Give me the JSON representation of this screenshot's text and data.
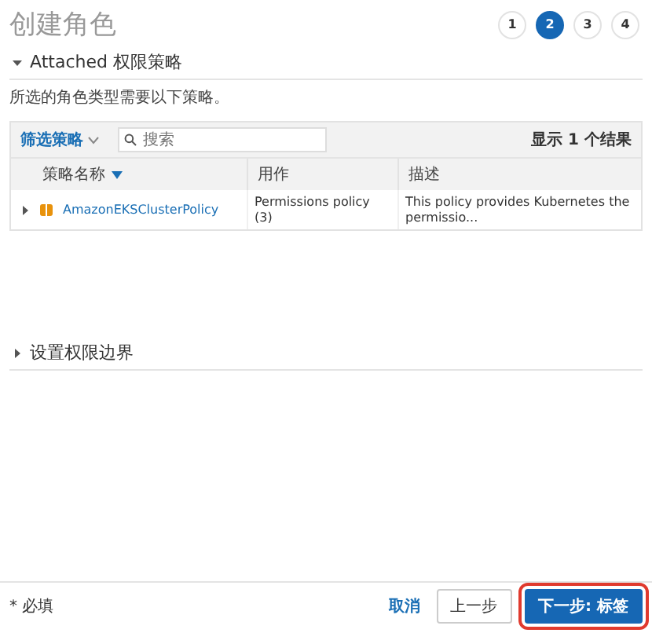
{
  "page_title": "创建角色",
  "steps": [
    {
      "label": "1",
      "selected": false
    },
    {
      "label": "2",
      "selected": true
    },
    {
      "label": "3",
      "selected": false
    },
    {
      "label": "4",
      "selected": false
    }
  ],
  "attached_section": {
    "title": "Attached 权限策略",
    "expanded": true,
    "description": "所选的角色类型需要以下策略。"
  },
  "toolbar": {
    "filter": "筛选策略",
    "search_placeholder": "搜索",
    "result_count": "显示 1 个结果"
  },
  "table": {
    "columns": [
      {
        "label": "策略名称",
        "sorted": true
      },
      {
        "label": "用作",
        "sorted": false
      },
      {
        "label": "描述",
        "sorted": false
      }
    ],
    "rows": [
      {
        "expanded": false,
        "name": "AmazonEKSClusterPolicy",
        "used_as": "Permissions policy (3)",
        "description": "This policy provides Kubernetes the permissio..."
      }
    ]
  },
  "boundary_section": {
    "title": "设置权限边界",
    "expanded": false
  },
  "footer": {
    "required_note": "* 必填",
    "buttons": [
      {
        "label": "取消",
        "kind": "link",
        "highlighted": false
      },
      {
        "label": "上一步",
        "kind": "secondary",
        "highlighted": false
      },
      {
        "label": "下一步: 标签",
        "kind": "primary",
        "highlighted": true
      }
    ]
  }
}
